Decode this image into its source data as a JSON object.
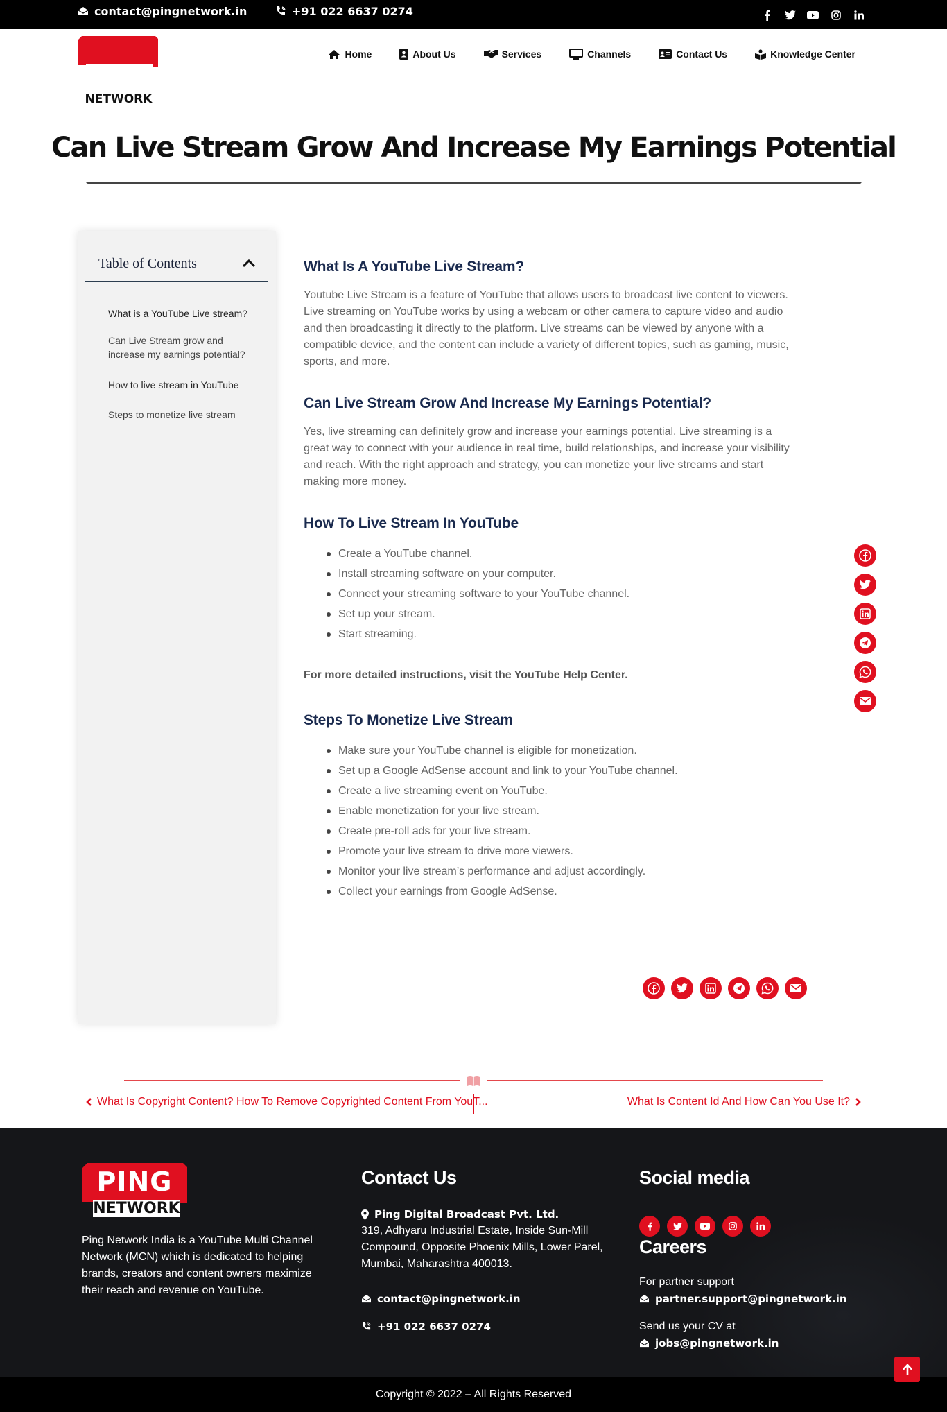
{
  "topbar": {
    "email": "contact@pingnetwork.in",
    "phone": "+91 022 6637 0274",
    "social_icons": [
      "facebook-icon",
      "twitter-icon",
      "youtube-icon",
      "instagram-icon",
      "linkedin-icon"
    ]
  },
  "logo": {
    "line1": "PING",
    "line2": "NETWORK"
  },
  "nav": {
    "items": [
      {
        "label": "Home",
        "icon": "home-icon"
      },
      {
        "label": "About Us",
        "icon": "id-badge-icon"
      },
      {
        "label": "Services",
        "icon": "handshake-icon"
      },
      {
        "label": "Channels",
        "icon": "monitor-icon"
      },
      {
        "label": "Contact Us",
        "icon": "address-card-icon"
      },
      {
        "label": "Knowledge Center",
        "icon": "book-reader-icon"
      }
    ]
  },
  "page_title": "Can Live Stream Grow And Increase My Earnings Potential",
  "toc": {
    "title": "Table of Contents",
    "items": [
      "What is a YouTube Live stream?",
      "Can Live Stream grow and increase my earnings potential?",
      "How to live stream in YouTube",
      "Steps to monetize live stream"
    ]
  },
  "article": {
    "s1_heading": "What Is A YouTube Live Stream?",
    "s1_text": "Youtube Live Stream is a feature of YouTube that allows users to broadcast live content to viewers. Live streaming on YouTube works by using a webcam or other camera to capture video and audio and then broadcasting it directly to the platform. Live streams can be viewed by anyone with a compatible device, and the content can include a variety of different topics, such as gaming, music, sports, and more.",
    "s2_heading": "Can Live Stream Grow And Increase My Earnings Potential?",
    "s2_text": "Yes, live streaming can definitely grow and increase your earnings potential. Live streaming is a great way to connect with your audience in real time, build relationships, and increase your visibility and reach. With the right approach and strategy, you can monetize your live streams and start making more money.",
    "s3_heading": "How To Live Stream In YouTube",
    "s3_list": [
      "Create a YouTube channel.",
      "Install streaming software on your computer.",
      "Connect your streaming software to your YouTube channel.",
      "Set up your stream.",
      "Start streaming."
    ],
    "s3_note": "For more detailed instructions, visit the YouTube Help Center.",
    "s4_heading": "Steps To Monetize Live Stream",
    "s4_list": [
      "Make sure your YouTube channel is eligible for monetization.",
      "Set up a Google AdSense account and link to your YouTube channel.",
      "Create a live streaming event on YouTube.",
      "Enable monetization for your live stream.",
      "Create pre-roll ads for your live stream.",
      "Promote your live stream to drive more viewers.",
      "Monitor your live stream’s performance and adjust accordingly.",
      "Collect your earnings from Google AdSense."
    ]
  },
  "share_icons": [
    "facebook-icon",
    "twitter-icon",
    "linkedin-icon",
    "telegram-icon",
    "whatsapp-icon",
    "envelope-icon"
  ],
  "post_nav": {
    "prev": "What Is Copyright Content? How To Remove Copyrighted Content From YouT...",
    "next": "What Is Content Id And How Can You Use It?"
  },
  "footer": {
    "about": "Ping Network India is a YouTube Multi Channel Network (MCN) which is dedicated to helping brands, creators and content owners maximize their reach and revenue on YouTube.",
    "contact_heading": "Contact Us",
    "company": "Ping Digital Broadcast Pvt. Ltd.",
    "address": "319, Adhyaru Industrial Estate, Inside Sun-Mill Compound, Opposite Phoenix Mills, Lower Parel, Mumbai, Maharashtra 400013.",
    "email": "contact@pingnetwork.in",
    "phone": "+91 022 6637 0274",
    "social_heading": "Social media",
    "careers_heading": "Careers",
    "partner_label": "For partner support",
    "partner_email": "partner.support@pingnetwork.in",
    "cv_label": "Send us your CV at",
    "jobs_email": "jobs@pingnetwork.in"
  },
  "copyright": "Copyright © 2022 – All Rights Reserved",
  "colors": {
    "brand_red": "#e01020",
    "footer_bg": "#151619",
    "heading_navy": "#1a2a4e"
  }
}
